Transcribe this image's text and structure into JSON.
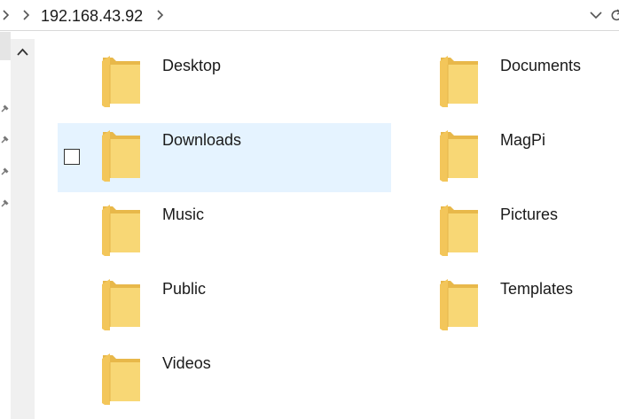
{
  "address_bar": {
    "path": "192.168.43.92"
  },
  "icons": {
    "nav_back": "chevron-right-icon",
    "dropdown": "chevron-down-icon",
    "refresh": "refresh-icon",
    "pin": "pin-icon",
    "scroll_up": "chevron-up-icon",
    "folder": "folder-icon"
  },
  "colors": {
    "selection": "#e5f3ff",
    "folder_body": "#f8d775",
    "folder_back": "#e8b84a"
  },
  "folders": [
    {
      "name": "Desktop",
      "selected": false
    },
    {
      "name": "Documents",
      "selected": false
    },
    {
      "name": "Downloads",
      "selected": true
    },
    {
      "name": "MagPi",
      "selected": false
    },
    {
      "name": "Music",
      "selected": false
    },
    {
      "name": "Pictures",
      "selected": false
    },
    {
      "name": "Public",
      "selected": false
    },
    {
      "name": "Templates",
      "selected": false
    },
    {
      "name": "Videos",
      "selected": false
    }
  ]
}
